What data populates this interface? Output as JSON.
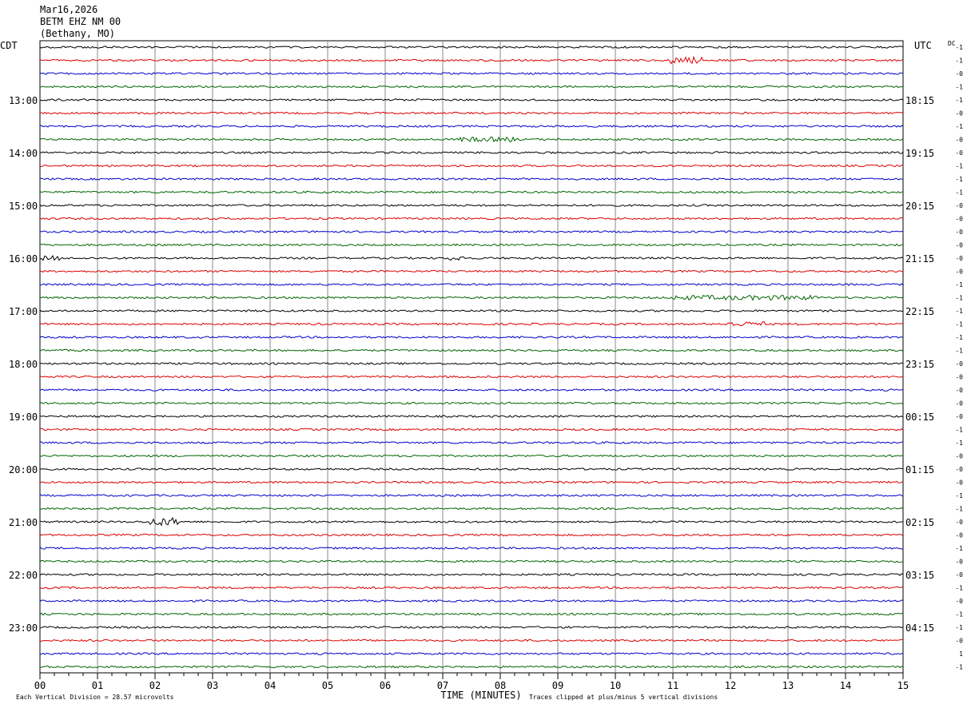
{
  "header": {
    "date": "Mar16,2026",
    "station": "BETM EHZ NM 00",
    "location": "(Bethany, MO)"
  },
  "chart_data": {
    "type": "line",
    "title": "BETM EHZ NM 00",
    "left_timezone": "CDT",
    "right_timezone": "UTC",
    "dc_label": "DC",
    "xlabel": "TIME (MINUTES)",
    "xlim": [
      0,
      15
    ],
    "x_ticks": [
      "00",
      "01",
      "02",
      "03",
      "04",
      "05",
      "06",
      "07",
      "08",
      "09",
      "10",
      "11",
      "12",
      "13",
      "14",
      "15"
    ],
    "rows_per_hour": 4,
    "row_count": 48,
    "trace_colors": [
      "#000000",
      "#dd0000",
      "#0000cc",
      "#006600"
    ],
    "left_hour_labels": [
      "13:00",
      "14:00",
      "15:00",
      "16:00",
      "17:00",
      "18:00",
      "19:00",
      "20:00",
      "21:00",
      "22:00",
      "23:00"
    ],
    "right_hour_labels": [
      "18:15",
      "19:15",
      "20:15",
      "21:15",
      "22:15",
      "23:15",
      "00:15",
      "01:15",
      "02:15",
      "03:15",
      "04:15"
    ],
    "dc_offsets": [
      "-1",
      "-1",
      "-0",
      "-1",
      "-1",
      "-0",
      "-1",
      "-0",
      "-0",
      "-1",
      "-1",
      "-1",
      "-0",
      "-0",
      "-0",
      "-0",
      "-0",
      "-0",
      "-1",
      "-1",
      "-1",
      "-1",
      "-1",
      "-1",
      "-0",
      "-0",
      "-0",
      "-0",
      "-0",
      "-1",
      "-1",
      "-0",
      "-0",
      "-0",
      "-1",
      "-1",
      "-0",
      "-0",
      "-1",
      "-0",
      "-0",
      "-1",
      "-0",
      "-1",
      "-1",
      "-0",
      "1",
      "-1"
    ],
    "events": [
      {
        "row": 1,
        "start_min": 10.95,
        "end_min": 11.55,
        "amplitude": 5
      },
      {
        "row": 7,
        "start_min": 7.3,
        "end_min": 8.3,
        "amplitude": 3
      },
      {
        "row": 16,
        "start_min": 0.05,
        "end_min": 0.35,
        "amplitude": 3
      },
      {
        "row": 16,
        "start_min": 7.1,
        "end_min": 7.4,
        "amplitude": 3
      },
      {
        "row": 19,
        "start_min": 11.0,
        "end_min": 13.5,
        "amplitude": 3
      },
      {
        "row": 21,
        "start_min": 11.9,
        "end_min": 12.6,
        "amplitude": 3
      },
      {
        "row": 36,
        "start_min": 1.9,
        "end_min": 2.4,
        "amplitude": 5
      }
    ],
    "footer_left": "Each Vertical Division =   28.57 microvolts",
    "footer_right": "Traces clipped at plus/minus 5 vertical divisions"
  }
}
